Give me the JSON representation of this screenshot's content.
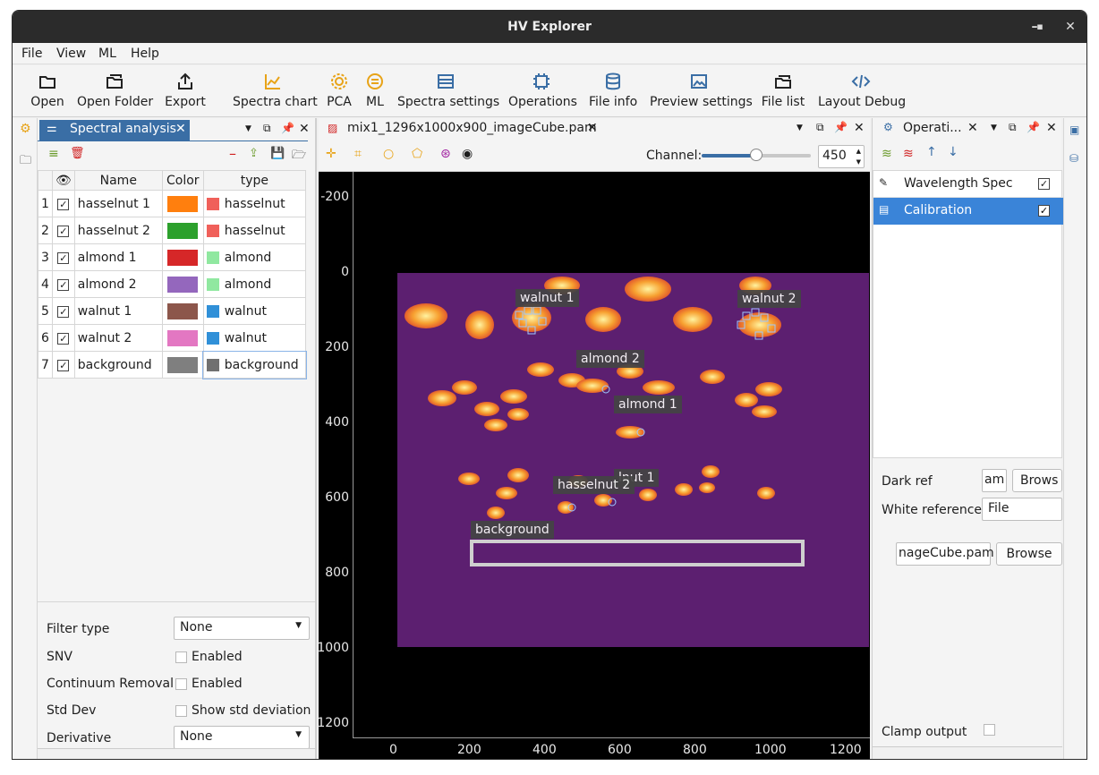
{
  "window": {
    "title": "HV Explorer",
    "min": "–",
    "max": "☐",
    "close": "✕"
  },
  "menu": [
    "File",
    "View",
    "ML",
    "Help"
  ],
  "toolbar": [
    "Open",
    "Open Folder",
    "Export",
    "Spectra chart",
    "PCA",
    "ML",
    "Spectra settings",
    "Operations",
    "File info",
    "Preview settings",
    "File list",
    "Layout Debug"
  ],
  "left": {
    "tab": "Spectral analysis",
    "headers": [
      "Name",
      "Color",
      "type"
    ],
    "rows": [
      {
        "n": "1",
        "name": "hasselnut 1",
        "color": "#ff7f0e",
        "type": "hasselnut",
        "tcolor": "#f0605a"
      },
      {
        "n": "2",
        "name": "hasselnut 2",
        "color": "#2ca02c",
        "type": "hasselnut",
        "tcolor": "#f0605a"
      },
      {
        "n": "3",
        "name": "almond 1",
        "color": "#d62728",
        "type": "almond",
        "tcolor": "#90e8a0"
      },
      {
        "n": "4",
        "name": "almond 2",
        "color": "#9467bd",
        "type": "almond",
        "tcolor": "#90e8a0"
      },
      {
        "n": "5",
        "name": "walnut 1",
        "color": "#8c564b",
        "type": "walnut",
        "tcolor": "#3090d8"
      },
      {
        "n": "6",
        "name": "walnut 2",
        "color": "#e377c2",
        "type": "walnut",
        "tcolor": "#3090d8"
      },
      {
        "n": "7",
        "name": "background",
        "color": "#7f7f7f",
        "type": "background",
        "tcolor": "#707070"
      }
    ],
    "filter_label": "Filter type",
    "filter_value": "None",
    "snv_label": "SNV",
    "snv_text": "Enabled",
    "cr_label": "Continuum Removal",
    "cr_text": "Enabled",
    "std_label": "Std Dev",
    "std_text": "Show std deviation",
    "deriv_label": "Derivative",
    "deriv_value": "None"
  },
  "center": {
    "tab": "mix1_1296x1000x900_imageCube.pam",
    "channel_label": "Channel:",
    "channel_value": "450",
    "yticks": [
      "-200",
      "0",
      "200",
      "400",
      "600",
      "800",
      "1000",
      "1200"
    ],
    "xticks": [
      "0",
      "200",
      "400",
      "600",
      "800",
      "1000",
      "1200"
    ],
    "labels": [
      "walnut 1",
      "walnut 2",
      "almond 2",
      "almond 1",
      "hasselnut 2",
      "lnut 1",
      "background"
    ]
  },
  "right": {
    "tab": "Operati...",
    "ops": [
      "Wavelength Spec",
      "Calibration"
    ],
    "dark_label": "Dark ref",
    "dark_value": "am",
    "browse": "Brows",
    "white_label": "White reference",
    "white_value": "File",
    "file_value": "nageCube.pam",
    "browse2": "Browse",
    "clamp_label": "Clamp output"
  }
}
